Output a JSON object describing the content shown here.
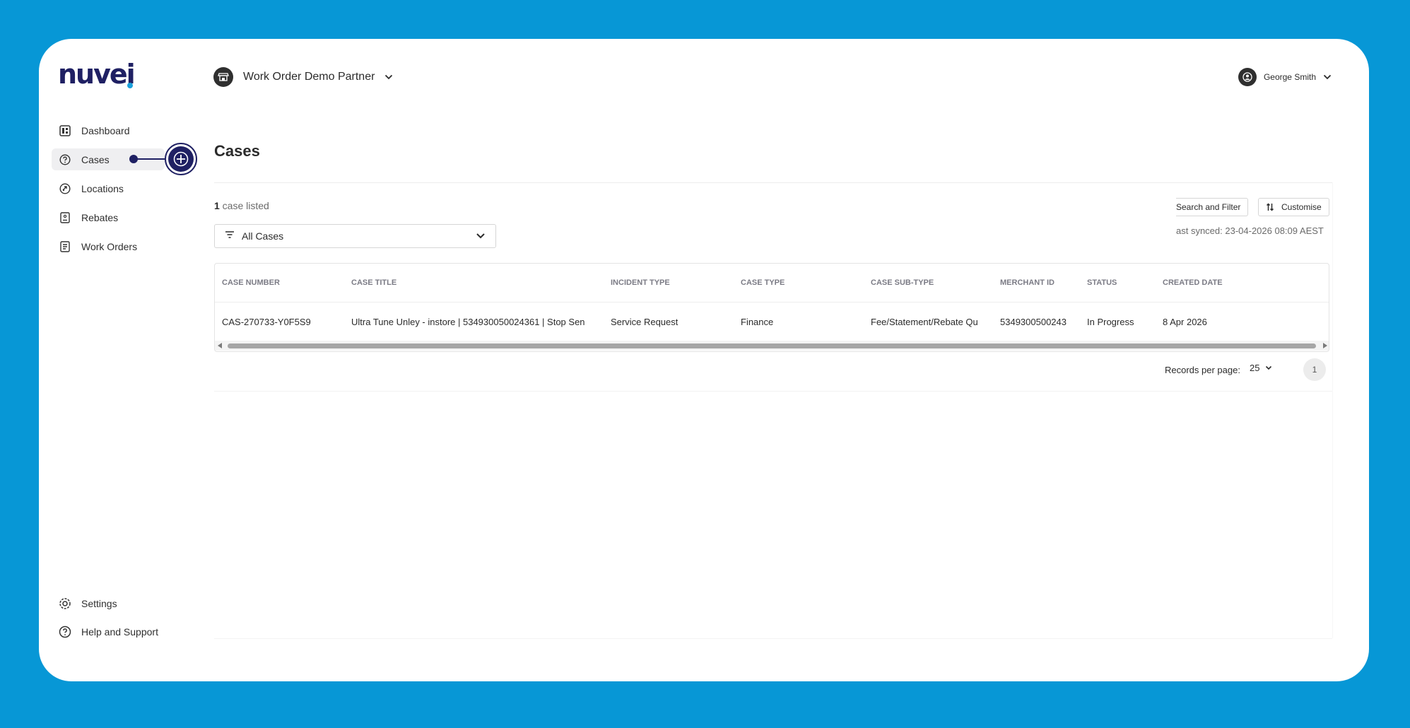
{
  "brand": {
    "logo_text": "nuvei",
    "accent": "#1f2063",
    "dot_color": "#1aa0dc",
    "background": "#0797d6"
  },
  "topbar": {
    "org_name": "Work Order Demo Partner",
    "org_icon": "storefront-icon",
    "user_name": "George Smith",
    "user_icon": "user-icon"
  },
  "sidebar": {
    "items": [
      {
        "label": "Dashboard",
        "icon": "dashboard-icon"
      },
      {
        "label": "Cases",
        "icon": "question-circle-icon",
        "active": true
      },
      {
        "label": "Locations",
        "icon": "location-link-icon"
      },
      {
        "label": "Rebates",
        "icon": "rebate-icon"
      },
      {
        "label": "Work Orders",
        "icon": "document-icon"
      }
    ],
    "bottom_items": [
      {
        "label": "Settings",
        "icon": "gear-icon"
      },
      {
        "label": "Help and Support",
        "icon": "help-icon"
      }
    ]
  },
  "page": {
    "title": "Cases",
    "case_count": "1",
    "case_count_suffix": " case listed",
    "view_select": "All Cases",
    "search_filter_label": "Search and Filter",
    "customise_label": "Customise",
    "last_synced": "ast synced: 23-04-2026 08:09 AEST"
  },
  "table": {
    "headers": [
      "CASE NUMBER",
      "CASE TITLE",
      "INCIDENT TYPE",
      "CASE TYPE",
      "CASE SUB-TYPE",
      "MERCHANT ID",
      "STATUS",
      "CREATED DATE"
    ],
    "rows": [
      [
        "CAS-270733-Y0F5S9",
        "Ultra Tune Unley - instore | 534930050024361 | Stop Sen",
        "Service Request",
        "Finance",
        "Fee/Statement/Rebate Qu",
        "5349300500243",
        "In Progress",
        "8 Apr 2026"
      ]
    ]
  },
  "pagination": {
    "records_per_page_label": "Records per page:",
    "records_per_page": "25",
    "current_page": "1"
  }
}
